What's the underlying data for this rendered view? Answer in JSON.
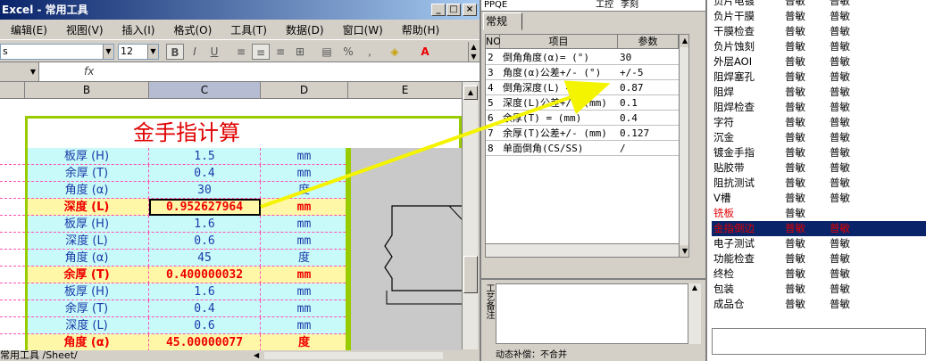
{
  "window": {
    "title": "Excel - 常用工具",
    "min": "_",
    "max": "□",
    "close": "×"
  },
  "menu": [
    "编辑(E)",
    "视图(V)",
    "插入(I)",
    "格式(O)",
    "工具(T)",
    "数据(D)",
    "窗口(W)",
    "帮助(H)"
  ],
  "toolbar": {
    "font_name": "s",
    "font_size": "12",
    "bold": "B",
    "italic": "I",
    "underline": "U",
    "percent": "%",
    "comma": ","
  },
  "formula": {
    "fx": "fx"
  },
  "columns": [
    "B",
    "C",
    "D",
    "E"
  ],
  "sheet": {
    "title": "金手指计算",
    "rows": [
      {
        "label": "板厚 (H)",
        "value": "1.5",
        "unit": "mm",
        "hl": false,
        "bg": "#c8fafa"
      },
      {
        "label": "余厚 (T)",
        "value": "0.4",
        "unit": "mm",
        "hl": false,
        "bg": "#c8fafa"
      },
      {
        "label": "角度 (α)",
        "value": "30",
        "unit": "度",
        "hl": false,
        "bg": "#c8fafa"
      },
      {
        "label": "深度 (L)",
        "value": "0.952627964",
        "unit": "mm",
        "hl": true,
        "bg": "#fff7a8"
      },
      {
        "label": "板厚 (H)",
        "value": "1.6",
        "unit": "mm",
        "hl": false,
        "bg": "#c8fafa"
      },
      {
        "label": "深度 (L)",
        "value": "0.6",
        "unit": "mm",
        "hl": false,
        "bg": "#c8fafa"
      },
      {
        "label": "角度 (α)",
        "value": "45",
        "unit": "度",
        "hl": false,
        "bg": "#c8fafa"
      },
      {
        "label": "余厚 (T)",
        "value": "0.400000032",
        "unit": "mm",
        "hl": true,
        "bg": "#fff7a8"
      },
      {
        "label": "板厚 (H)",
        "value": "1.6",
        "unit": "mm",
        "hl": false,
        "bg": "#c8fafa"
      },
      {
        "label": "余厚 (T)",
        "value": "0.4",
        "unit": "mm",
        "hl": false,
        "bg": "#c8fafa"
      },
      {
        "label": "深度 (L)",
        "value": "0.6",
        "unit": "mm",
        "hl": false,
        "bg": "#c8fafa"
      },
      {
        "label": "角度 (α)",
        "value": "45.00000077",
        "unit": "度",
        "hl": true,
        "bg": "#fff7a8"
      }
    ]
  },
  "sheet_tabs": "常用工具 /Sheet/",
  "panel": {
    "top_labels": [
      "PPQE",
      "工控",
      "李刻"
    ],
    "tab": "常规",
    "headers": [
      "NO",
      "项目",
      "参数"
    ],
    "rows": [
      {
        "no": "2",
        "item": "倒角角度(α)= (°)",
        "param": "30"
      },
      {
        "no": "3",
        "item": "角度(α)公差+/- (°)",
        "param": "+/-5"
      },
      {
        "no": "4",
        "item": "倒角深度(L) = (mm)",
        "param": "0.87"
      },
      {
        "no": "5",
        "item": "深度(L)公差+/- (mm)",
        "param": "0.1"
      },
      {
        "no": "6",
        "item": "余厚(T) = (mm)",
        "param": "0.4"
      },
      {
        "no": "7",
        "item": "余厚(T)公差+/- (mm)",
        "param": "0.127"
      },
      {
        "no": "8",
        "item": "单面倒角(CS/SS)",
        "param": "/"
      }
    ],
    "side_label": "工艺备注",
    "status": "动态补偿：不合并"
  },
  "steps": [
    {
      "name": "负片电镀",
      "a": "普敏",
      "b": "普敏",
      "color": "#000",
      "sel": false
    },
    {
      "name": "负片干膜",
      "a": "普敏",
      "b": "普敏",
      "color": "#000",
      "sel": false
    },
    {
      "name": "干膜检查",
      "a": "普敏",
      "b": "普敏",
      "color": "#000",
      "sel": false
    },
    {
      "name": "负片蚀刻",
      "a": "普敏",
      "b": "普敏",
      "color": "#000",
      "sel": false
    },
    {
      "name": "外层AOI",
      "a": "普敏",
      "b": "普敏",
      "color": "#000",
      "sel": false
    },
    {
      "name": "阻焊塞孔",
      "a": "普敏",
      "b": "普敏",
      "color": "#000",
      "sel": false
    },
    {
      "name": "阻焊",
      "a": "普敏",
      "b": "普敏",
      "color": "#000",
      "sel": false
    },
    {
      "name": "阻焊检查",
      "a": "普敏",
      "b": "普敏",
      "color": "#000",
      "sel": false
    },
    {
      "name": "字符",
      "a": "普敏",
      "b": "普敏",
      "color": "#000",
      "sel": false
    },
    {
      "name": "沉金",
      "a": "普敏",
      "b": "普敏",
      "color": "#000",
      "sel": false
    },
    {
      "name": "镀金手指",
      "a": "普敏",
      "b": "普敏",
      "color": "#000",
      "sel": false
    },
    {
      "name": "贴胶带",
      "a": "普敏",
      "b": "普敏",
      "color": "#000",
      "sel": false
    },
    {
      "name": "阻抗测试",
      "a": "普敏",
      "b": "普敏",
      "color": "#000",
      "sel": false
    },
    {
      "name": "V槽",
      "a": "普敏",
      "b": "普敏",
      "color": "#000",
      "sel": false
    },
    {
      "name": "铣板",
      "a": "普敏",
      "b": "",
      "color": "#e00000",
      "sel": false
    },
    {
      "name": "金指倒边",
      "a": "普敏",
      "b": "普敏",
      "color": "#e00000",
      "sel": true
    },
    {
      "name": "电子测试",
      "a": "普敏",
      "b": "普敏",
      "color": "#000",
      "sel": false
    },
    {
      "name": "功能检查",
      "a": "普敏",
      "b": "普敏",
      "color": "#000",
      "sel": false
    },
    {
      "name": "终检",
      "a": "普敏",
      "b": "普敏",
      "color": "#000",
      "sel": false
    },
    {
      "name": "包装",
      "a": "普敏",
      "b": "普敏",
      "color": "#000",
      "sel": false
    },
    {
      "name": "成品仓",
      "a": "普敏",
      "b": "普敏",
      "color": "#000",
      "sel": false
    }
  ],
  "colors": {
    "arrow": "#f4f400",
    "title_red": "#e00000",
    "cell_blue": "#1a3aa8",
    "selection": "#0a246a"
  }
}
